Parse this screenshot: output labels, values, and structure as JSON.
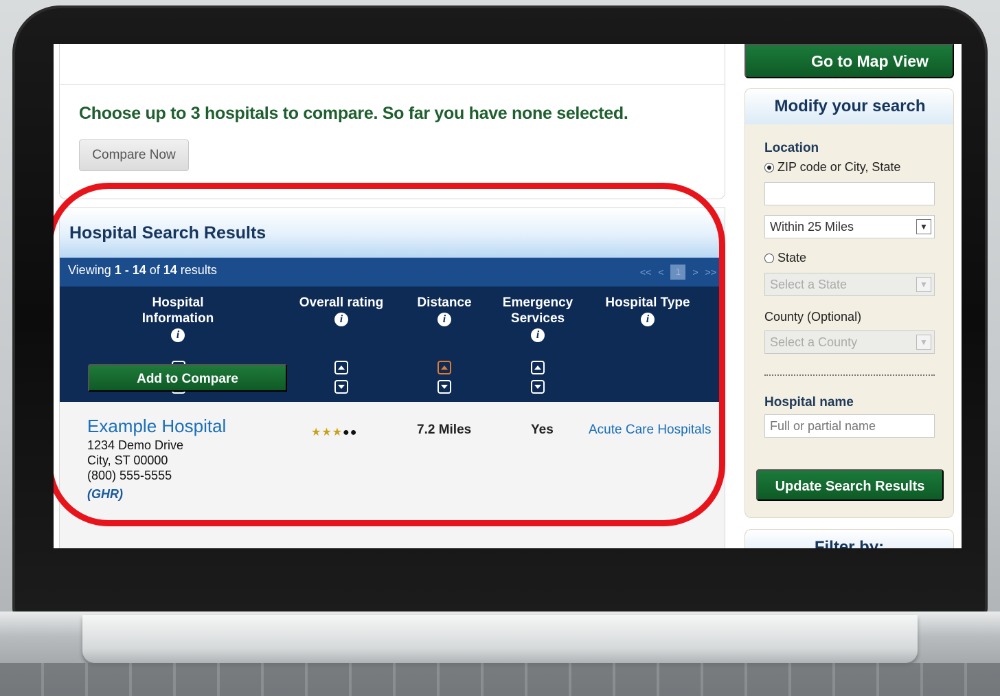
{
  "compare": {
    "message": "Choose up to 3 hospitals to compare.  So far you have none selected.",
    "button": "Compare Now"
  },
  "results": {
    "title": "Hospital Search Results",
    "viewing_prefix": "Viewing ",
    "viewing_range": "1 - 14",
    "viewing_of": " of ",
    "viewing_total": "14",
    "viewing_suffix": " results",
    "pager": {
      "first": "<<",
      "prev": "<",
      "page": "1",
      "next": ">",
      "last": ">>"
    },
    "columns": [
      {
        "label": "Hospital Information"
      },
      {
        "label": "Overall rating"
      },
      {
        "label": "Distance"
      },
      {
        "label": "Emergency Services"
      },
      {
        "label": "Hospital Type"
      }
    ],
    "rows": [
      {
        "name": "Example Hospital",
        "address1": "1234 Demo Drive",
        "address2": "City, ST 00000",
        "phone": "(800) 555-5555",
        "logo_text": "GHR",
        "rating_stars": 3,
        "rating_max": 5,
        "distance": "7.2 Miles",
        "emergency": "Yes",
        "type": "Acute Care Hospitals"
      }
    ],
    "add_compare": "Add to Compare"
  },
  "sidebar": {
    "map_button": "Go to Map View",
    "modify_title": "Modify your search",
    "location_label": "Location",
    "zip_option": "ZIP code or City, State",
    "zip_value": "",
    "distance_select": "Within 25 Miles",
    "state_option": "State",
    "state_select": "Select a State",
    "county_label": "County (Optional)",
    "county_select": "Select a County",
    "hospital_name_label": "Hospital name",
    "hospital_name_placeholder": "Full or partial name",
    "update_button": "Update Search Results",
    "filter_title": "Filter by:"
  },
  "colors": {
    "accent_green": "#1f5f2f",
    "button_green": "#0e5a26",
    "header_navy": "#0d2b55",
    "viewing_blue": "#1b4c8c",
    "link_blue": "#1a6fb8",
    "highlight_red": "#e8141c"
  }
}
